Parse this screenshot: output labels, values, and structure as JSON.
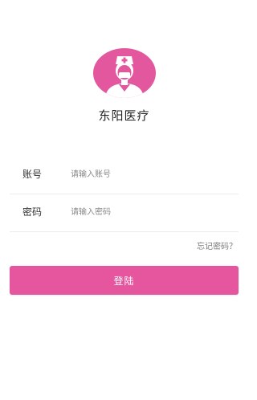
{
  "brand": {
    "app_name": "东阳医疗",
    "logo_icon": "nurse-avatar-icon",
    "accent_color": "#e5569f"
  },
  "login_form": {
    "account": {
      "label": "账号",
      "placeholder": "请输入账号",
      "value": ""
    },
    "password": {
      "label": "密码",
      "placeholder": "请输入密码",
      "value": ""
    },
    "forgot_password_label": "忘记密码？",
    "submit_label": "登陆"
  }
}
